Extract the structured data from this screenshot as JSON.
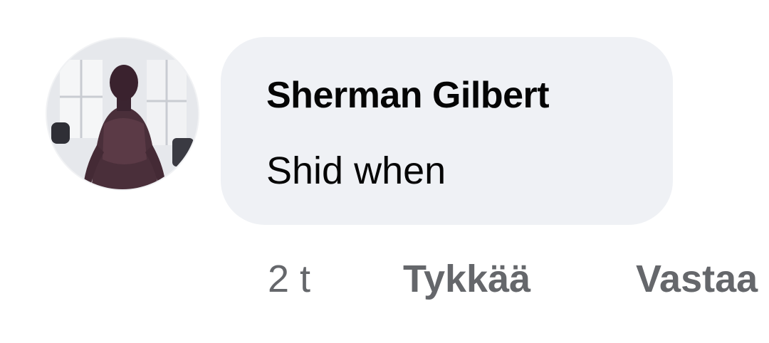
{
  "comment": {
    "author": "Sherman Gilbert",
    "text": "Shid when",
    "timestamp": "2 t",
    "like_label": "Tykkää",
    "reply_label": "Vastaa"
  },
  "colors": {
    "bubble_background": "#eff1f5",
    "primary_text": "#050505",
    "secondary_text": "#65676b"
  },
  "icons": {
    "avatar": "profile-photo"
  }
}
